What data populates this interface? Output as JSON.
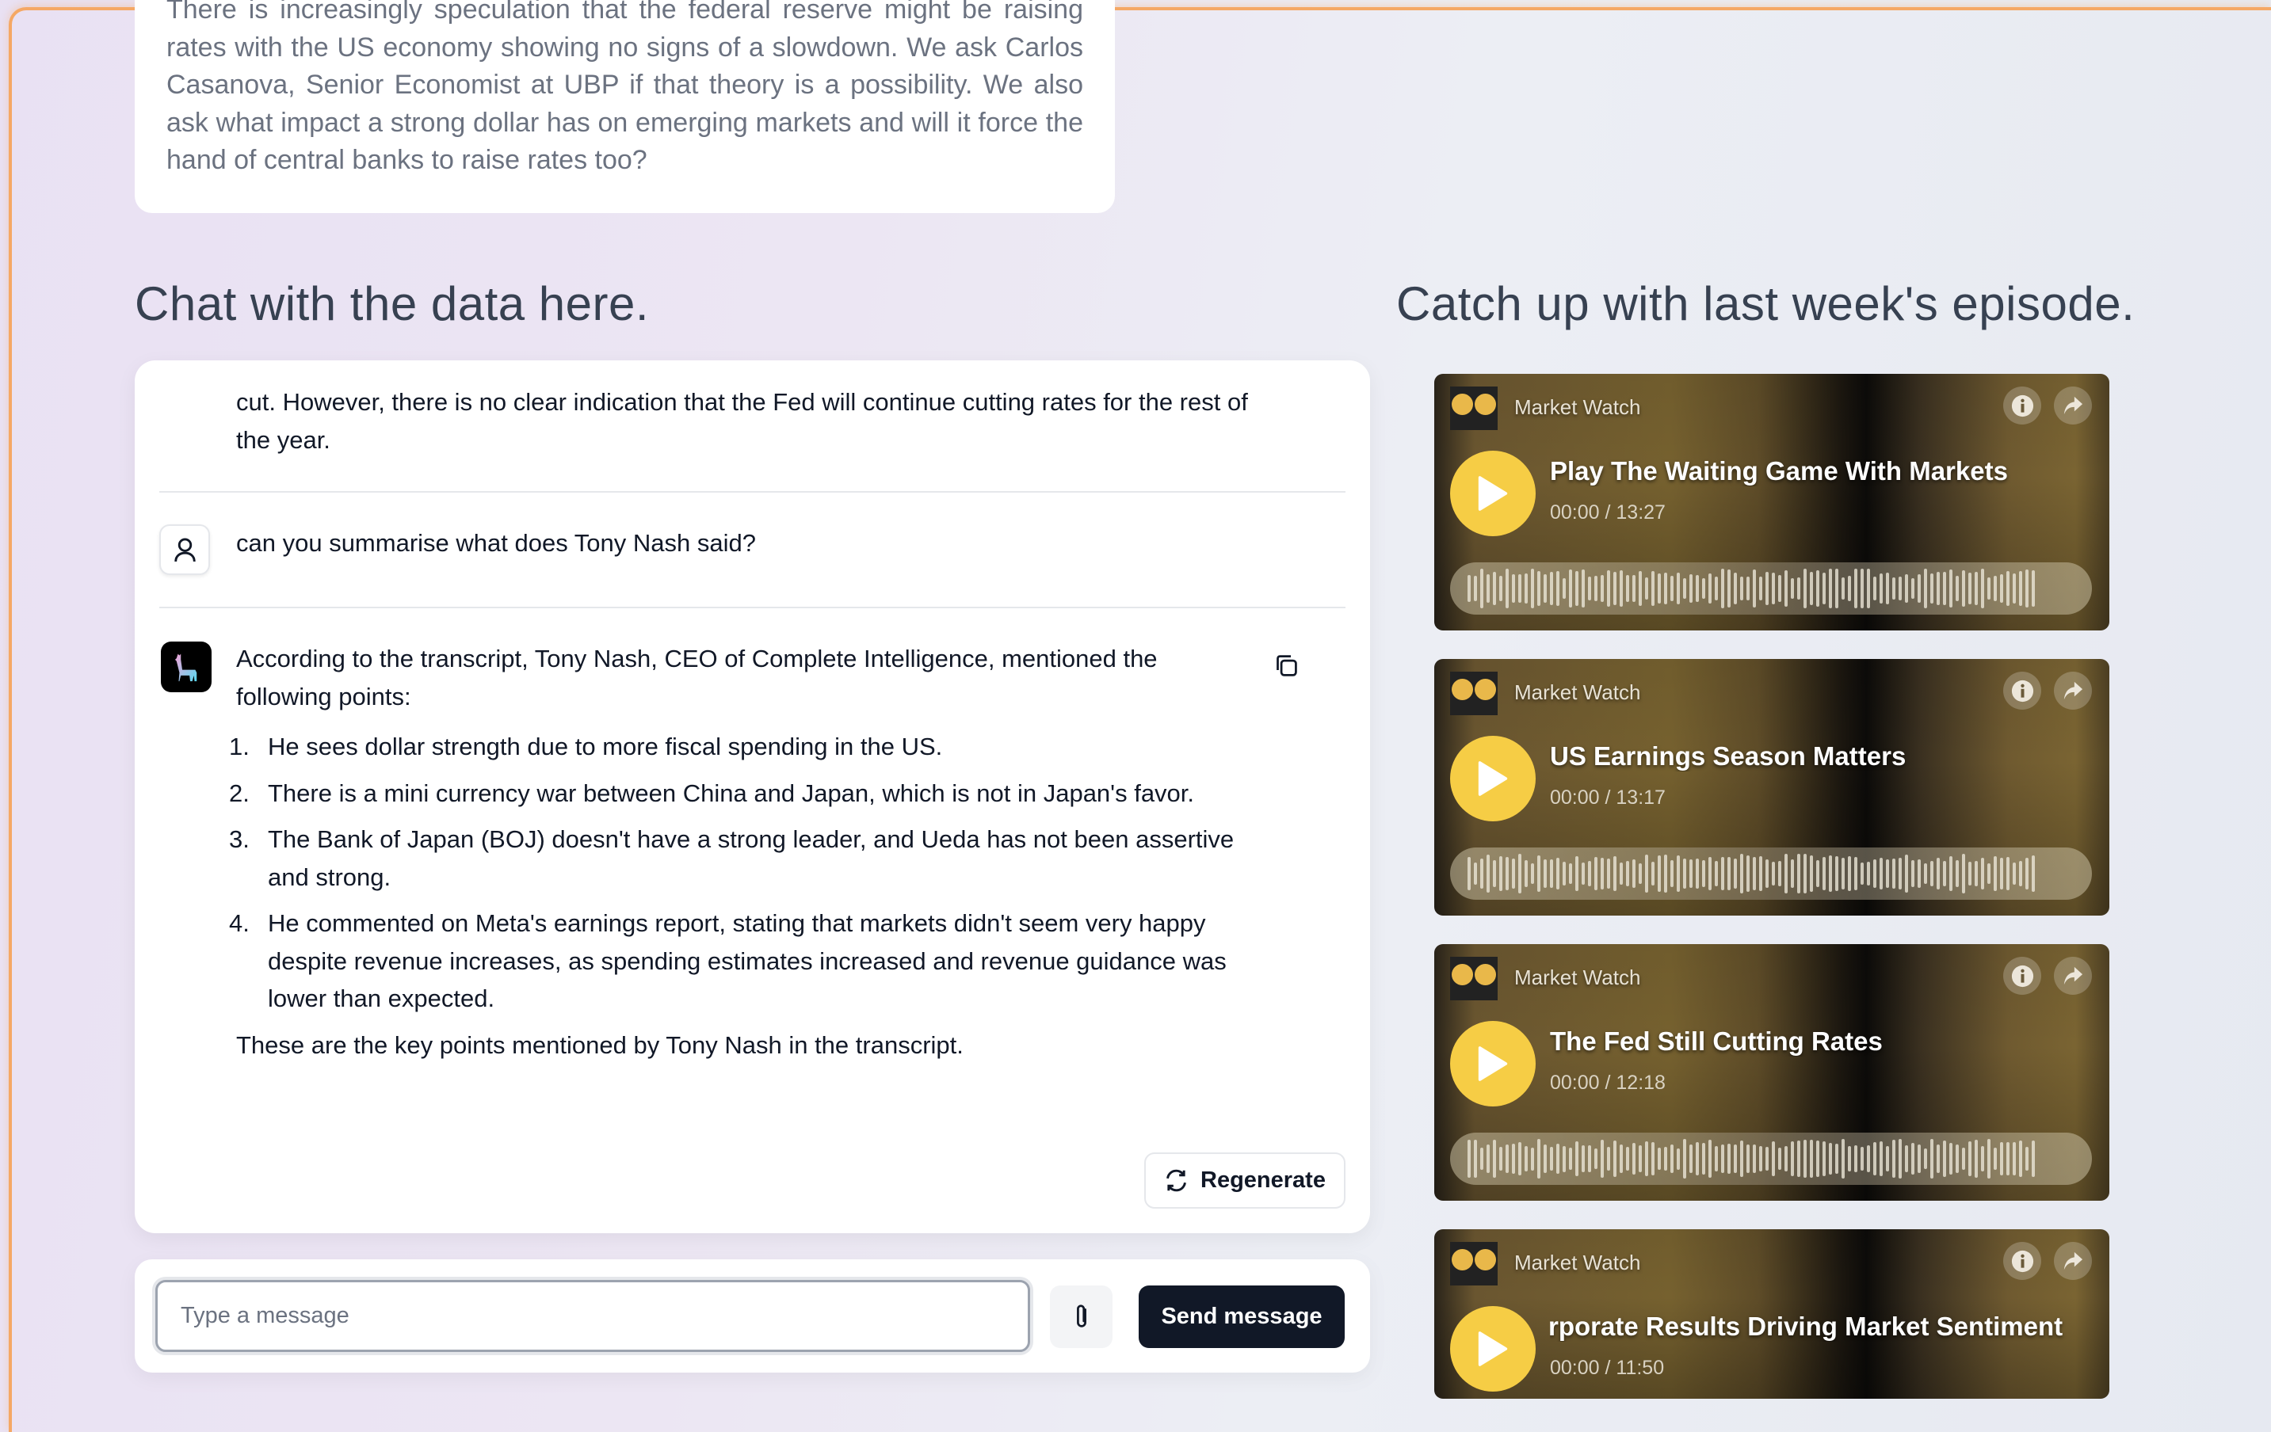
{
  "description": "There is increasingly speculation that the federal reserve might be raising rates with the US economy showing no signs of a slowdown. We ask Carlos Casanova, Senior Economist at UBP if that theory is a possibility. We also ask what impact a strong dollar has on emerging markets and will it force the hand of central banks to raise rates too?",
  "chat": {
    "heading": "Chat with the data here.",
    "prev_message": "cut. However, there is no clear indication that the Fed will continue cutting rates for the rest of the year.",
    "user_message": "can you summarise what does Tony Nash said?",
    "bot_intro": "According to the transcript, Tony Nash, CEO of Complete Intelligence, mentioned the following points:",
    "bot_points": [
      {
        "n": "1.",
        "text": "He sees dollar strength due to more fiscal spending in the US."
      },
      {
        "n": "2.",
        "text": "There is a mini currency war between China and Japan, which is not in Japan's favor."
      },
      {
        "n": "3.",
        "text": "The Bank of Japan (BOJ) doesn't have a strong leader, and Ueda has not been assertive and strong."
      },
      {
        "n": "4.",
        "text": "He commented on Meta's earnings report, stating that markets didn't seem very happy despite revenue increases, as spending estimates increased and revenue guidance was lower than expected."
      }
    ],
    "bot_outro": "These are the key points mentioned by Tony Nash in the transcript.",
    "regenerate_label": "Regenerate",
    "input_placeholder": "Type a message",
    "send_label": "Send message"
  },
  "episodes": {
    "heading": "Catch up with last week's episode.",
    "items": [
      {
        "show": "Market Watch",
        "title": "Play The Waiting Game With Markets",
        "time": "00:00 / 13:27"
      },
      {
        "show": "Market Watch",
        "title": "US Earnings Season Matters",
        "time": "00:00 / 13:17"
      },
      {
        "show": "Market Watch",
        "title": "The Fed Still Cutting Rates",
        "time": "00:00 / 12:18"
      },
      {
        "show": "Market Watch",
        "title": "Corporate Results Driving Market Sentiment",
        "time": "00:00 / 11:50"
      }
    ]
  },
  "colors": {
    "accent_play": "#f6cd45",
    "send_bg": "#111827",
    "frame": "#f5a865"
  }
}
